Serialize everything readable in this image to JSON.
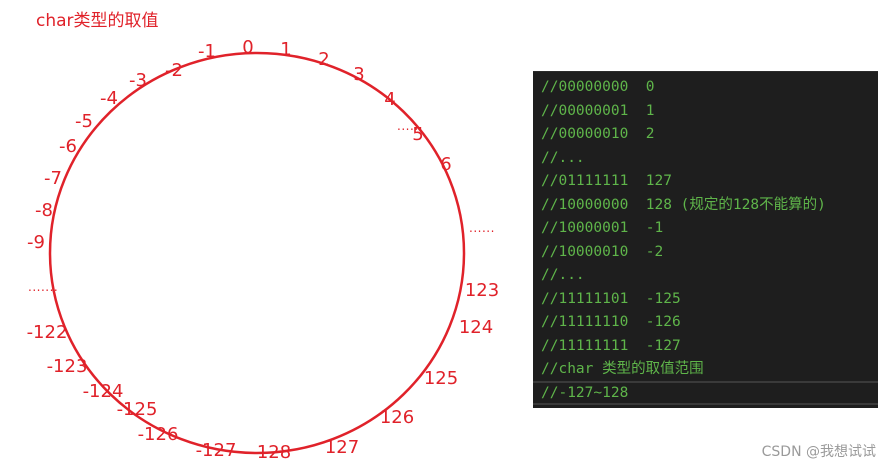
{
  "title": "char类型的取值",
  "accent_color": "#e0222a",
  "code_color": "#5fb54a",
  "circle_labels": [
    "0",
    "1",
    "2",
    "3",
    "4",
    "5",
    "6",
    "123",
    "124",
    "125",
    "126",
    "127",
    "128",
    "-127",
    "-126",
    "-125",
    "-124",
    "-123",
    "-122",
    "-9",
    "-8",
    "-7",
    "-6",
    "-5",
    "-4",
    "-3",
    "-2",
    "-1"
  ],
  "gap_markers": [
    "......",
    "......",
    "......."
  ],
  "code_lines": [
    "//00000000  0",
    "//00000001  1",
    "//00000010  2",
    "//...",
    "//01111111  127",
    "//10000000  128 (规定的128不能算的)",
    "//10000001  -1",
    "//10000010  -2",
    "//...",
    "//11111101  -125",
    "//11111110  -126",
    "//11111111  -127",
    "//char 类型的取值范围",
    "//-127~128"
  ],
  "watermark": "CSDN @我想试试"
}
